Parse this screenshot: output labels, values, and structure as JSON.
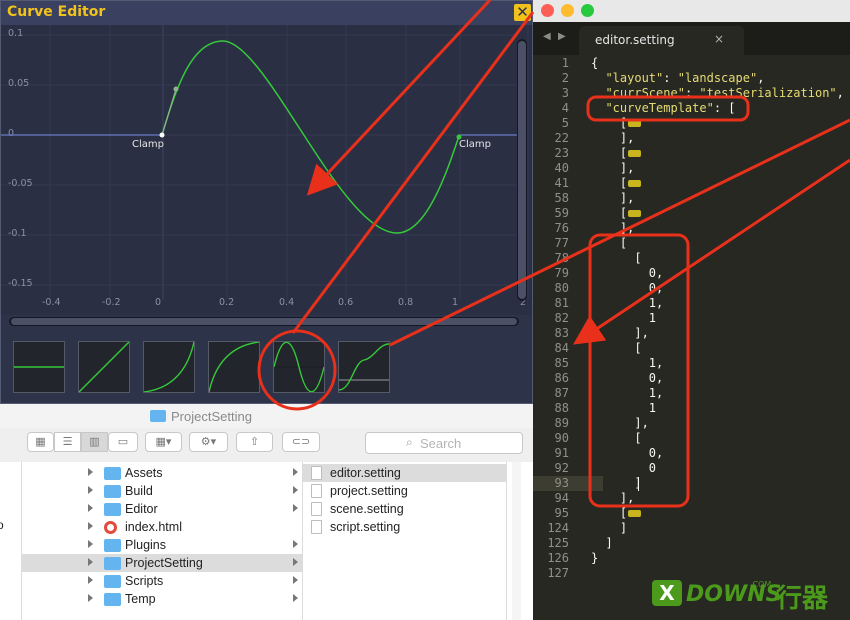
{
  "curve_editor": {
    "title": "Curve Editor",
    "close_glyph": "✕",
    "y_ticks": [
      "0.1",
      "0.05",
      "0",
      "-0.05",
      "-0.1",
      "-0.15"
    ],
    "x_ticks": [
      "-0.4",
      "-0.2",
      "0",
      "0.2",
      "0.4",
      "0.6",
      "0.8",
      "1",
      "2"
    ],
    "clamp_labels": [
      "Clamp",
      "Clamp"
    ],
    "curve_color": "#35c93a",
    "presets": [
      "constant-preset",
      "linear-preset",
      "ease-in-preset",
      "ease-out-preset",
      "sine-preset",
      "sine-steep-preset"
    ]
  },
  "finder": {
    "title": "ProjectSetting",
    "search_placeholder": "Search",
    "toolbar_icons": [
      "icon-view-icon",
      "list-view-icon",
      "column-view-icon",
      "coverflow-view-icon",
      "arrange-icon",
      "action-gear-icon",
      "share-icon",
      "tag-icon"
    ],
    "col1_items": [
      {
        "name": "Assets",
        "kind": "folder"
      },
      {
        "name": "Build",
        "kind": "folder"
      },
      {
        "name": "Editor",
        "kind": "folder"
      },
      {
        "name": "index.html",
        "kind": "chrome"
      },
      {
        "name": "Plugins",
        "kind": "folder"
      },
      {
        "name": "ProjectSetting",
        "kind": "folder",
        "selected": true
      },
      {
        "name": "Scripts",
        "kind": "folder"
      },
      {
        "name": "Temp",
        "kind": "folder"
      }
    ],
    "col2_items": [
      {
        "name": "editor.setting",
        "selected": true
      },
      {
        "name": "project.setting"
      },
      {
        "name": "scene.setting"
      },
      {
        "name": "script.setting"
      }
    ],
    "left_edge_char": "o"
  },
  "code_editor": {
    "tab_label": "editor.setting",
    "tab_close": "×",
    "lines": [
      {
        "n": "1",
        "t": "{"
      },
      {
        "n": "2",
        "t": "  \"layout\": \"landscape\","
      },
      {
        "n": "3",
        "t": "  \"currScene\": \"testSerialization\","
      },
      {
        "n": "4",
        "t": "  \"curveTemplate\": ["
      },
      {
        "n": "5",
        "t": "    [",
        "fold": true
      },
      {
        "n": "22",
        "t": "    ],"
      },
      {
        "n": "23",
        "t": "    [",
        "fold": true
      },
      {
        "n": "40",
        "t": "    ],"
      },
      {
        "n": "41",
        "t": "    [",
        "fold": true
      },
      {
        "n": "58",
        "t": "    ],"
      },
      {
        "n": "59",
        "t": "    [",
        "fold": true
      },
      {
        "n": "76",
        "t": "    ],"
      },
      {
        "n": "77",
        "t": "    ["
      },
      {
        "n": "78",
        "t": "      ["
      },
      {
        "n": "79",
        "t": "        0,"
      },
      {
        "n": "80",
        "t": "        0,"
      },
      {
        "n": "81",
        "t": "        1,"
      },
      {
        "n": "82",
        "t": "        1"
      },
      {
        "n": "83",
        "t": "      ],"
      },
      {
        "n": "84",
        "t": "      ["
      },
      {
        "n": "85",
        "t": "        1,"
      },
      {
        "n": "86",
        "t": "        0,"
      },
      {
        "n": "87",
        "t": "        1,"
      },
      {
        "n": "88",
        "t": "        1"
      },
      {
        "n": "89",
        "t": "      ],"
      },
      {
        "n": "90",
        "t": "      ["
      },
      {
        "n": "91",
        "t": "        0,"
      },
      {
        "n": "92",
        "t": "        0"
      },
      {
        "n": "93",
        "t": "      ]"
      },
      {
        "n": "94",
        "t": "    ],"
      },
      {
        "n": "95",
        "t": "    [",
        "fold": true
      },
      {
        "n": "124",
        "t": "    ]"
      },
      {
        "n": "125",
        "t": "  ]"
      },
      {
        "n": "126",
        "t": "}"
      },
      {
        "n": "127",
        "t": ""
      }
    ],
    "highlight_color": "#e8301a"
  },
  "watermark": {
    "logo": "X",
    "text": "DOWNS",
    "small": ".COM",
    "cn": "行器"
  }
}
